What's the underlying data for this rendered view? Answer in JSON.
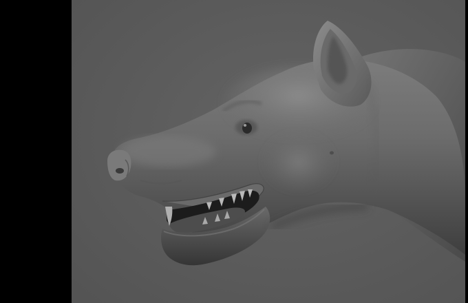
{
  "scene": {
    "subject": "sculpted-canid-head-render",
    "colors": {
      "letterbox": "#000000",
      "background": "#5e5e5e",
      "clay_light": "#8a8a8a",
      "clay_mid": "#6e6e6e",
      "clay_dark": "#3a3a3a",
      "mouth_interior": "#1c1c1c",
      "tongue": "#4d4d4d",
      "teeth": "#b9b9b9"
    }
  }
}
